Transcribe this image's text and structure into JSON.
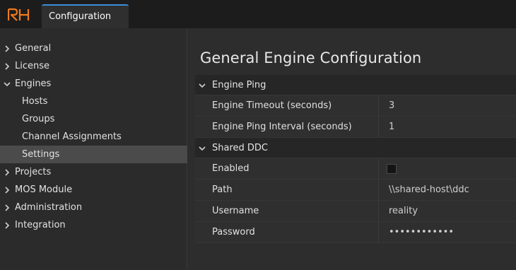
{
  "app": {
    "logo_text": "RH",
    "accent_color": "#f07a1e",
    "tab_accent_color": "#3a8fd6"
  },
  "tabs": [
    {
      "label": "Configuration",
      "active": true
    }
  ],
  "sidebar": {
    "items": [
      {
        "label": "General",
        "expanded": false,
        "level": 0
      },
      {
        "label": "License",
        "expanded": false,
        "level": 0
      },
      {
        "label": "Engines",
        "expanded": true,
        "level": 0
      },
      {
        "label": "Hosts",
        "level": 1
      },
      {
        "label": "Groups",
        "level": 1
      },
      {
        "label": "Channel Assignments",
        "level": 1
      },
      {
        "label": "Settings",
        "level": 1,
        "selected": true
      },
      {
        "label": "Projects",
        "expanded": false,
        "level": 0
      },
      {
        "label": "MOS Module",
        "expanded": false,
        "level": 0
      },
      {
        "label": "Administration",
        "expanded": false,
        "level": 0
      },
      {
        "label": "Integration",
        "expanded": false,
        "level": 0
      }
    ]
  },
  "main": {
    "title": "General Engine Configuration",
    "sections": [
      {
        "title": "Engine Ping",
        "expanded": true,
        "rows": [
          {
            "key": "Engine Timeout (seconds)",
            "value": "3"
          },
          {
            "key": "Engine Ping Interval (seconds)",
            "value": "1"
          }
        ]
      },
      {
        "title": "Shared DDC",
        "expanded": true,
        "rows": [
          {
            "key": "Enabled",
            "value": "",
            "checked": false
          },
          {
            "key": "Path",
            "value": "\\\\shared-host\\ddc"
          },
          {
            "key": "Username",
            "value": "reality"
          },
          {
            "key": "Password",
            "value": "••••••••••••"
          }
        ]
      }
    ]
  }
}
